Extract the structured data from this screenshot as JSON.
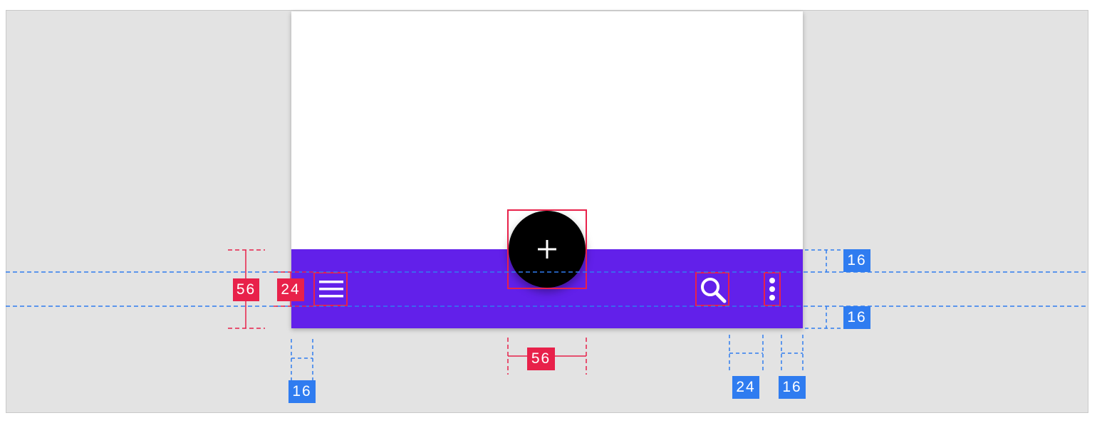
{
  "colors": {
    "app_bar": "#6220ea",
    "fab": "#000000",
    "keyline_red": "#e8214a",
    "keyline_blue": "#2f7cf0",
    "canvas": "#e3e3e3"
  },
  "icons": {
    "navigation": "menu-icon",
    "fab": "plus-icon",
    "search": "search-icon",
    "overflow": "more-vertical-icon"
  },
  "measurements": {
    "bar_height": "56",
    "nav_icon_size": "24",
    "fab_width": "56",
    "left_margin": "16",
    "icon_top_padding": "16",
    "icon_bottom_padding": "16",
    "search_icon_size": "24",
    "right_margin": "16"
  }
}
